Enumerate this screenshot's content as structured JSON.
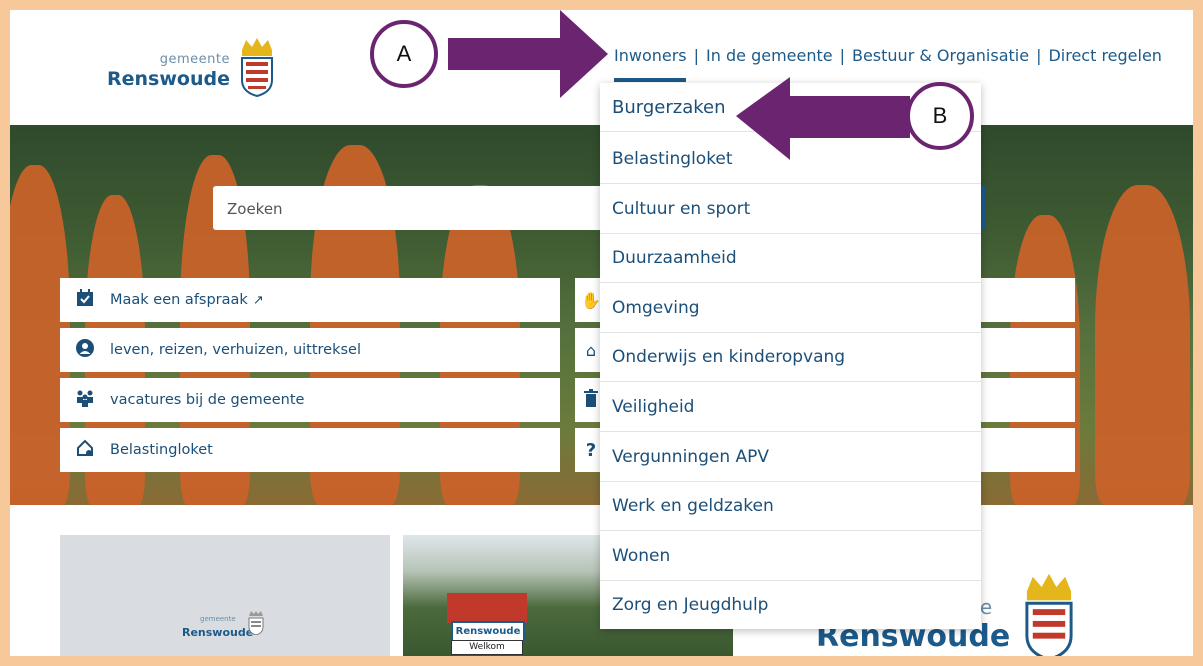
{
  "logo": {
    "small": "gemeente",
    "big": "Renswoude"
  },
  "nav": {
    "items": [
      "Inwoners",
      "In de gemeente",
      "Bestuur & Organisatie",
      "Direct regelen"
    ],
    "separator": "|"
  },
  "search": {
    "placeholder": "Zoeken"
  },
  "quick_links_left": [
    {
      "label": "Maak een afspraak",
      "icon": "calendar-check-icon",
      "external": "↗"
    },
    {
      "label": "leven, reizen, verhuizen, uittreksel",
      "icon": "user-circle-icon"
    },
    {
      "label": "vacatures bij de gemeente",
      "icon": "people-group-icon"
    },
    {
      "label": "Belastingloket",
      "icon": "house-euro-icon"
    }
  ],
  "quick_links_right_icons": [
    "hand-icon",
    "house-icon",
    "trash-icon",
    "question-icon"
  ],
  "question_mark": "?",
  "dropdown": {
    "items": [
      "Burgerzaken",
      "Belastingloket",
      "Cultuur en sport",
      "Duurzaamheid",
      "Omgeving",
      "Onderwijs en kinderopvang",
      "Veiligheid",
      "Vergunningen APV",
      "Werk en geldzaken",
      "Wonen",
      "Zorg en Jeugdhulp"
    ]
  },
  "cards": {
    "card1": {
      "logo_small": "gemeente",
      "logo_big": "Renswoude"
    },
    "card2": {
      "sign_name": "Renswoude",
      "sign_welcome": "Welkom"
    },
    "card3": {
      "logo_small": "te",
      "logo_big": "Renswoude"
    }
  },
  "annotations": {
    "a": "A",
    "b": "B"
  },
  "colors": {
    "brand_blue": "#1c5a8a",
    "annotation_purple": "#6b2570",
    "frame_orange": "#f7c99a",
    "silhouette_orange": "#c8622a"
  }
}
